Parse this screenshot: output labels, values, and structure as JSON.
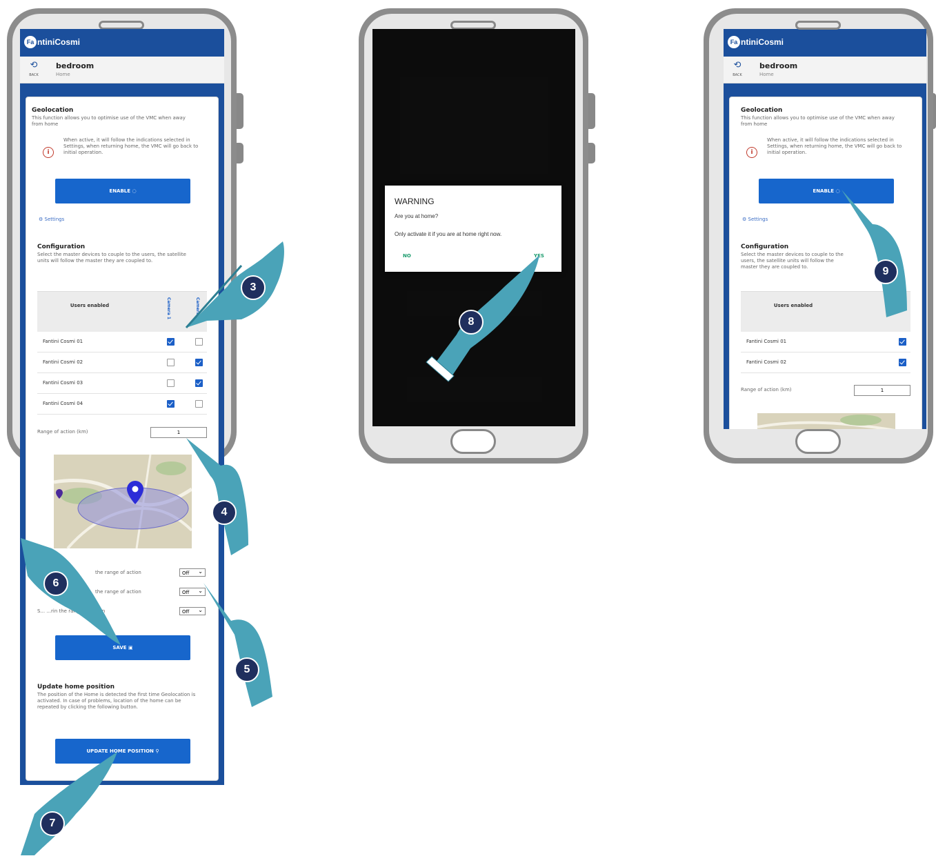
{
  "app": {
    "brand": "FantiniCosmi",
    "room_name": "bedroom",
    "room_sub": "Home",
    "back_label": "BACK"
  },
  "geo": {
    "title": "Geolocation",
    "desc": "This function allows you to optimise use of the VMC when away from home",
    "info": "When active, it will follow the indications selected in Settings, when returning home, the VMC will go back to initial operation.",
    "enable_label": "ENABLE",
    "settings_label": "Settings"
  },
  "config": {
    "title": "Configuration",
    "desc": "Select the master devices to couple to the users, the satellite units will follow the master they are coupled to.",
    "users_header": "Users enabled",
    "col1": "Camera 1",
    "col2": "Camera 2",
    "rows": [
      {
        "name": "Fantini Cosmi 01",
        "c1": true,
        "c2": false
      },
      {
        "name": "Fantini Cosmi 02",
        "c1": false,
        "c2": true
      },
      {
        "name": "Fantini Cosmi 03",
        "c1": false,
        "c2": true
      },
      {
        "name": "Fantini Cosmi 04",
        "c1": true,
        "c2": false
      }
    ],
    "range_label": "Range of action (km)",
    "range_value": "1",
    "options": [
      {
        "label": "the range of action",
        "value": "Off"
      },
      {
        "label": "the range of action",
        "value": "Off"
      },
      {
        "label": "S... ...rin the range of action",
        "value": "Off"
      }
    ],
    "save_label": "SAVE"
  },
  "update": {
    "title": "Update home position",
    "desc": "The position of the Home is detected the first time Geolocation is activated. In case of problems, location of the home can be repeated by clicking the following button.",
    "button_label": "UPDATE HOME POSITION"
  },
  "dialog": {
    "title": "WARNING",
    "question": "Are you at home?",
    "note": "Only activate it if you are at home right now.",
    "no_label": "NO",
    "yes_label": "YES"
  },
  "phone3": {
    "rows": [
      {
        "name": "Fantini Cosmi 01",
        "checked": true
      },
      {
        "name": "Fantini Cosmi 02",
        "checked": true
      }
    ],
    "range_value": "1"
  },
  "steps": {
    "s3": "3",
    "s4": "4",
    "s5": "5",
    "s6": "6",
    "s7": "7",
    "s8": "8",
    "s9": "9"
  },
  "colors": {
    "header": "#1b4f9c",
    "button": "#1766cc",
    "marker": "#1f2f5e",
    "hand": "#4aa3b8",
    "accept": "#1a9b6c"
  }
}
